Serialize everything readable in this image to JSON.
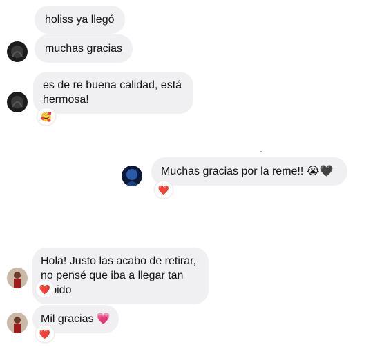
{
  "messages": [
    {
      "text": "holiss ya llegó",
      "sender": "them"
    },
    {
      "text": "muchas gracias",
      "sender": "them"
    },
    {
      "text": "es de re buena calidad, está hermosa!",
      "sender": "them",
      "reaction": "🥰"
    },
    {
      "text": "Muchas gracias por la reme!! 😭🖤",
      "sender": "me",
      "reaction": "❤️"
    },
    {
      "text": "Hola! Justo las acabo de retirar, no pensé que iba a llegar tan rápido",
      "sender": "them2",
      "reaction": "❤️"
    },
    {
      "text": "Mil gracias 💗",
      "sender": "them2",
      "reaction": "❤️"
    }
  ],
  "colors": {
    "bubble": "#f0f0f2",
    "background": "#ffffff",
    "text": "#111111"
  }
}
